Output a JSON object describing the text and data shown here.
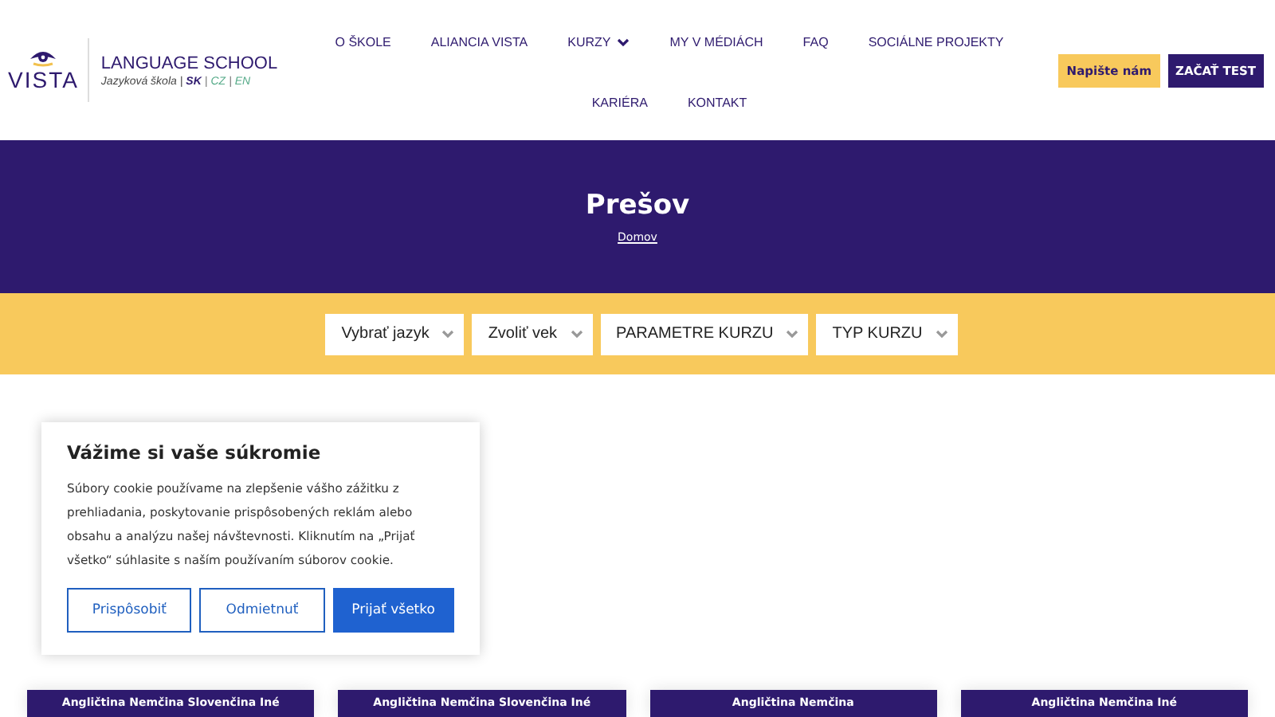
{
  "logo": {
    "wordmark": "VISTA",
    "title": "LANGUAGE SCHOOL",
    "subtitle": "Jazyková škola |",
    "separator": "|",
    "languages": [
      {
        "label": "SK",
        "selected": true
      },
      {
        "label": "CZ",
        "selected": false
      },
      {
        "label": "EN",
        "selected": false
      }
    ]
  },
  "nav": [
    {
      "label": "O ŠKOLE",
      "dropdown": false
    },
    {
      "label": "ALIANCIA VISTA",
      "dropdown": false
    },
    {
      "label": "KURZY",
      "dropdown": true
    },
    {
      "label": "MY V MÉDIÁCH",
      "dropdown": false
    },
    {
      "label": "FAQ",
      "dropdown": false
    },
    {
      "label": "SOCIÁLNE PROJEKTY",
      "dropdown": false
    },
    {
      "label": "KARIÉRA",
      "dropdown": false
    },
    {
      "label": "KONTAKT",
      "dropdown": false
    }
  ],
  "header_buttons": [
    {
      "label": "Napište nám",
      "kind": "secondary"
    },
    {
      "label": "ZAČAŤ TEST",
      "kind": "primary"
    }
  ],
  "hero": {
    "title": "Prešov",
    "breadcrumb": "Domov"
  },
  "filters": [
    "Vybrať jazyk",
    "Zvoliť vek",
    "PARAMETRE KURZU",
    "TYP KURZU"
  ],
  "cookie": {
    "title": "Vážime si vaše súkromie",
    "text": "Súbory cookie používame na zlepšenie vášho zážitku z prehliadania, poskytovanie prispôsobených reklám alebo obsahu a analýzu našej návštevnosti. Kliknutím na „Prijať všetko“ súhlasite s naším používaním súborov cookie.",
    "buttons": [
      {
        "label": "Prispôsobiť",
        "kind": "outline"
      },
      {
        "label": "Odmietnuť",
        "kind": "outline"
      },
      {
        "label": "Prijať všetko",
        "kind": "filled"
      }
    ]
  },
  "cards": [
    {
      "languages": "Angličtina Nemčina Slovenčina Iné"
    },
    {
      "languages": "Angličtina Nemčina Slovenčina Iné"
    },
    {
      "languages": "Angličtina Nemčina"
    },
    {
      "languages": "Angličtina Nemčina Iné"
    }
  ]
}
